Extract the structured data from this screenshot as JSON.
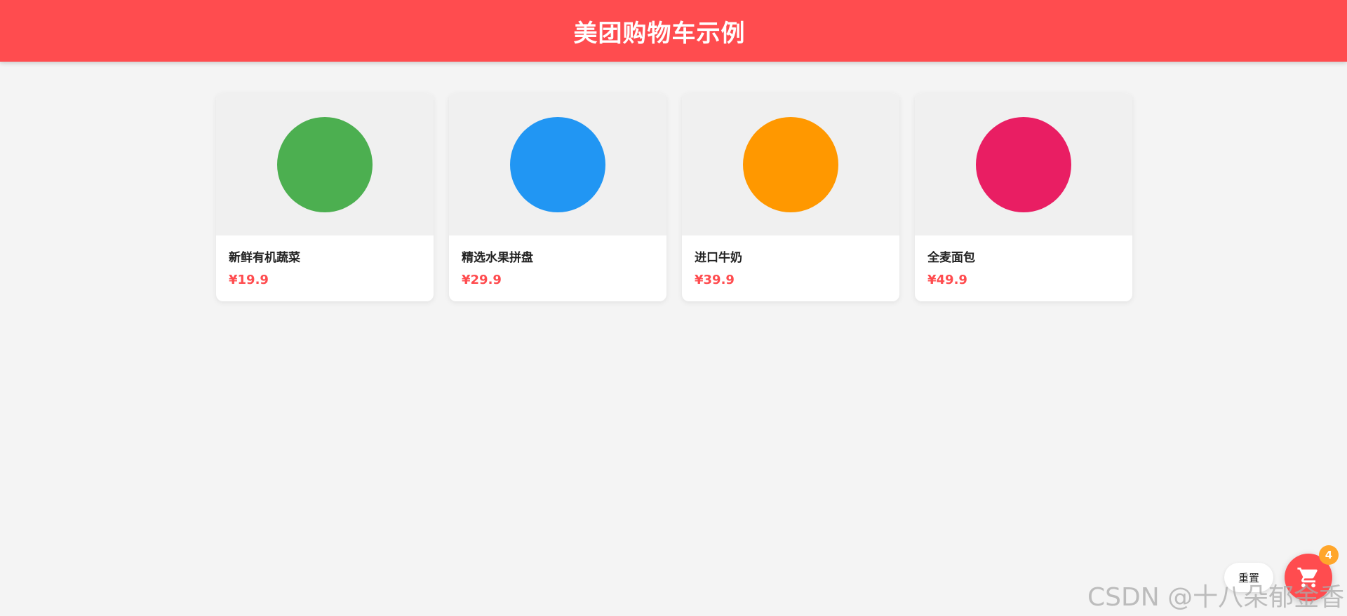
{
  "header": {
    "title": "美团购物车示例",
    "background": "#ff4c4f"
  },
  "products": [
    {
      "name": "新鲜有机蔬菜",
      "price": "¥19.9",
      "color": "#4caf50"
    },
    {
      "name": "精选水果拼盘",
      "price": "¥29.9",
      "color": "#2196f3"
    },
    {
      "name": "进口牛奶",
      "price": "¥39.9",
      "color": "#ff9800"
    },
    {
      "name": "全麦面包",
      "price": "¥49.9",
      "color": "#e91e63"
    }
  ],
  "actions": {
    "reset_label": "重置",
    "cart_icon": "shopping-cart-icon",
    "cart_count": "4",
    "accent": "#ff4c4f",
    "badge_color": "#ffa62b"
  },
  "watermark": "CSDN @十八朵郁金香"
}
